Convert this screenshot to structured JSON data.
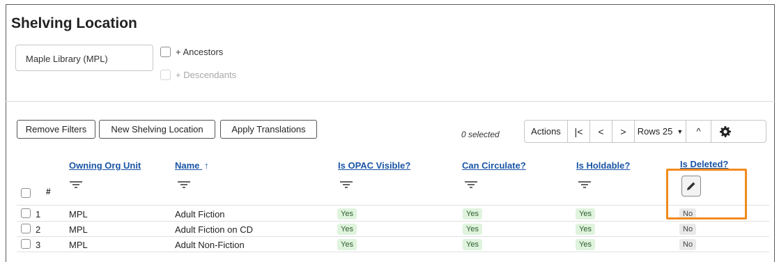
{
  "page": {
    "title": "Shelving Location"
  },
  "org_selector": {
    "value": "Maple Library (MPL)"
  },
  "scope_options": {
    "ancestors_label": "+ Ancestors",
    "descendants_label": "+ Descendants"
  },
  "buttons": {
    "remove_filters": "Remove Filters",
    "new_shelving_location": "New Shelving Location",
    "apply_translations": "Apply Translations"
  },
  "toolbar": {
    "selected_count": "0 selected",
    "actions": "Actions",
    "first_page_glyph": "|<",
    "prev_page_glyph": "<",
    "next_page_glyph": ">",
    "rows_label": "Rows 25",
    "rows_caret": "▼",
    "collapse_glyph": "^",
    "settings_icon": "gear-icon"
  },
  "table": {
    "row_number_header": "#",
    "columns": {
      "owning_org_unit": "Owning Org Unit",
      "name": "Name",
      "name_sort_arrow": "↑",
      "is_opac_visible": "Is OPAC Visible?",
      "can_circulate": "Can Circulate?",
      "is_holdable": "Is Holdable?",
      "is_deleted": "Is Deleted?"
    },
    "rows": [
      {
        "num": "1",
        "org": "MPL",
        "name": "Adult Fiction",
        "opac": "Yes",
        "circ": "Yes",
        "hold": "Yes",
        "deleted": "No"
      },
      {
        "num": "2",
        "org": "MPL",
        "name": "Adult Fiction on CD",
        "opac": "Yes",
        "circ": "Yes",
        "hold": "Yes",
        "deleted": "No"
      },
      {
        "num": "3",
        "org": "MPL",
        "name": "Adult Non-Fiction",
        "opac": "Yes",
        "circ": "Yes",
        "hold": "Yes",
        "deleted": "No"
      }
    ]
  },
  "colors": {
    "link": "#1a55a6",
    "highlight": "#f28a1c",
    "yes_badge": "#dff3dd",
    "no_badge": "#e9e9e9"
  }
}
